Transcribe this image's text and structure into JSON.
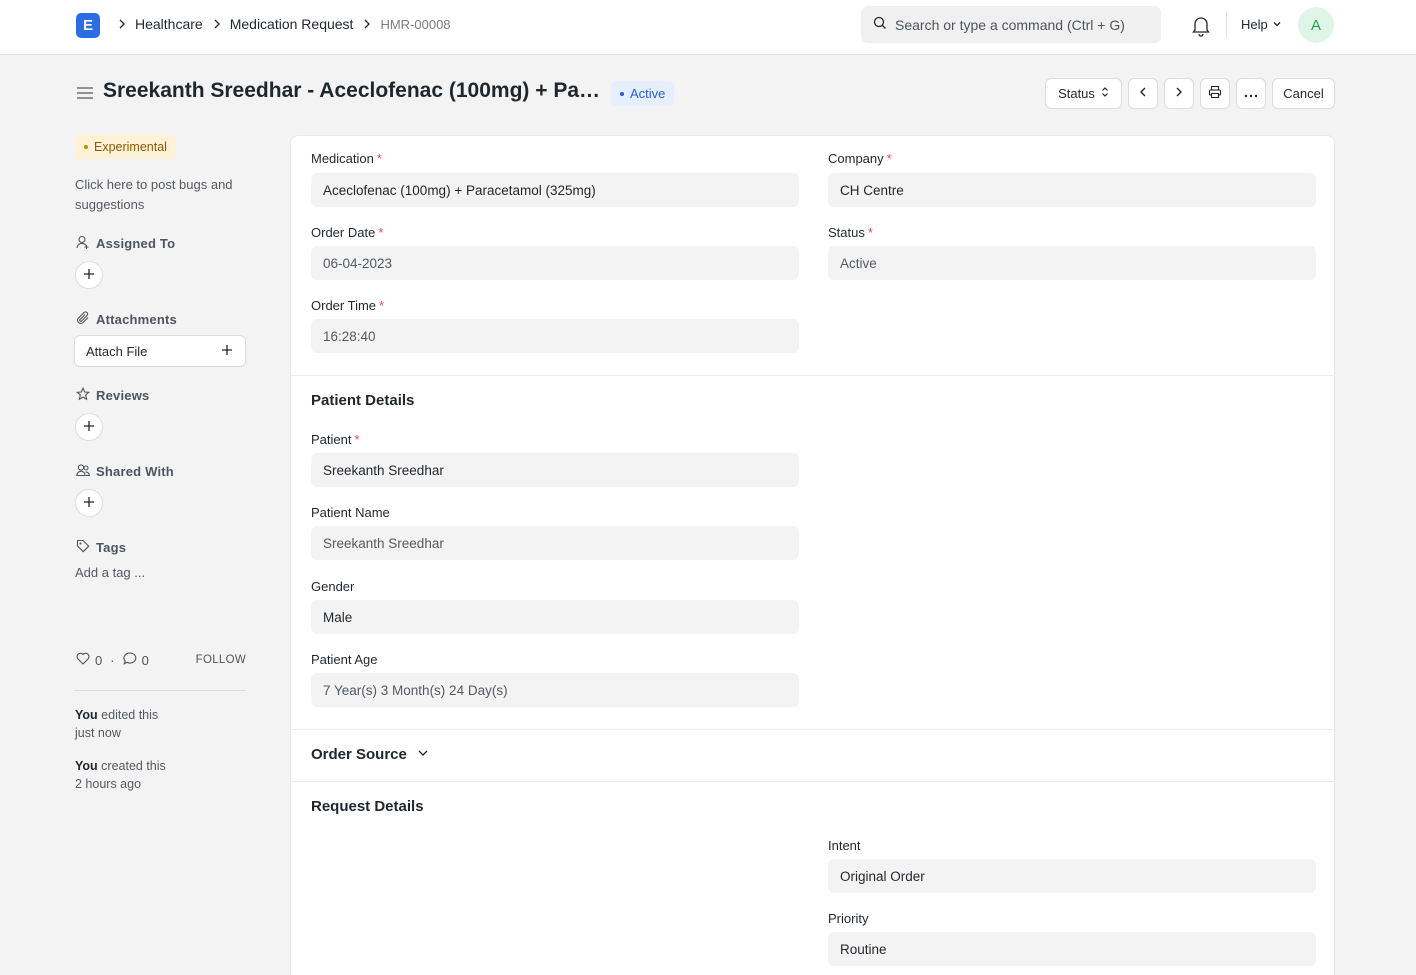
{
  "navbar": {
    "logo_letter": "E",
    "breadcrumbs": [
      "Healthcare",
      "Medication Request",
      "HMR-00008"
    ],
    "search_placeholder": "Search or type a command (Ctrl + G)",
    "help_label": "Help",
    "avatar_initial": "A"
  },
  "header": {
    "title": "Sreekanth Sreedhar - Aceclofenac (100mg) + Par...",
    "status_pill": "Active",
    "status_button": "Status",
    "cancel_button": "Cancel"
  },
  "sidebar": {
    "badge": "Experimental",
    "bug_text": "Click here to post bugs and suggestions",
    "assigned_to": "Assigned To",
    "attachments": "Attachments",
    "attach_file": "Attach File",
    "reviews": "Reviews",
    "shared_with": "Shared With",
    "tags": "Tags",
    "add_tag": "Add a tag ...",
    "likes_count": "0",
    "comments_count": "0",
    "follow": "FOLLOW",
    "activity": [
      {
        "who": "You",
        "action": " edited this",
        "when": "just now"
      },
      {
        "who": "You",
        "action": " created this",
        "when": "2 hours ago"
      }
    ]
  },
  "form": {
    "medication": {
      "label": "Medication",
      "value": "Aceclofenac (100mg) + Paracetamol (325mg)"
    },
    "company": {
      "label": "Company",
      "value": "CH Centre"
    },
    "order_date": {
      "label": "Order Date",
      "value": "06-04-2023"
    },
    "status": {
      "label": "Status",
      "value": "Active"
    },
    "order_time": {
      "label": "Order Time",
      "value": "16:28:40"
    },
    "patient_section": "Patient Details",
    "patient": {
      "label": "Patient",
      "value": "Sreekanth Sreedhar"
    },
    "patient_name": {
      "label": "Patient Name",
      "value": "Sreekanth Sreedhar"
    },
    "gender": {
      "label": "Gender",
      "value": "Male"
    },
    "patient_age": {
      "label": "Patient Age",
      "value": "7 Year(s) 3 Month(s) 24 Day(s)"
    },
    "order_source_section": "Order Source",
    "request_section": "Request Details",
    "intent": {
      "label": "Intent",
      "value": "Original Order"
    },
    "priority": {
      "label": "Priority",
      "value": "Routine"
    }
  }
}
